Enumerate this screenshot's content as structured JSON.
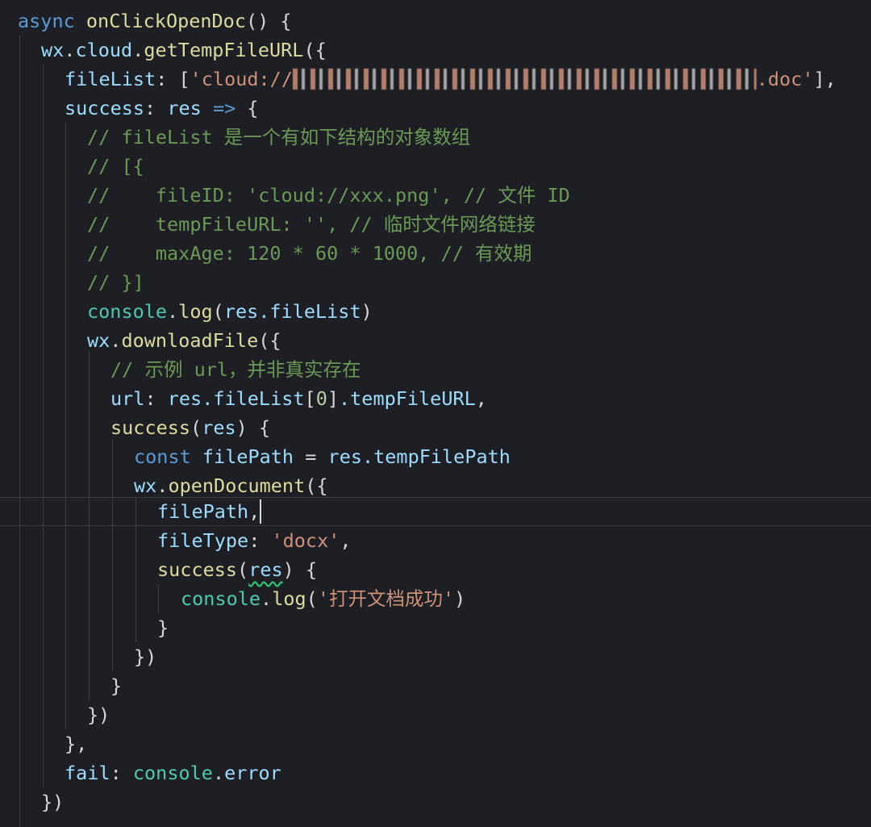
{
  "code": {
    "l1_kw": "async",
    "l1_fn": "onClickOpenDoc",
    "l1_rest": "() {",
    "l2_obj": "wx",
    "l2_dot1": ".",
    "l2_cloud": "cloud",
    "l2_dot2": ".",
    "l2_fn": "getTempFileURL",
    "l2_rest": "({",
    "l3_key": "fileList",
    "l3_sep": ": [",
    "l3_str_start": "'cloud://",
    "l3_str_end": ".doc'",
    "l3_rest": "],",
    "l4_key": "success",
    "l4_sep": ": ",
    "l4_res": "res",
    "l4_arrow": " => ",
    "l4_brace": "{",
    "l5": "// fileList 是一个有如下结构的对象数组",
    "l6": "// [{",
    "l7": "//    fileID: 'cloud://xxx.png', // 文件 ID",
    "l8": "//    tempFileURL: '', // 临时文件网络链接",
    "l9": "//    maxAge: 120 * 60 * 1000, // 有效期",
    "l10": "// }]",
    "l11_console": "console",
    "l11_dot": ".",
    "l11_log": "log",
    "l11_open": "(",
    "l11_arg": "res.fileList",
    "l11_close": ")",
    "l12_obj": "wx",
    "l12_dot": ".",
    "l12_fn": "downloadFile",
    "l12_rest": "({",
    "l13": "// 示例 url，并非真实存在",
    "l14_key": "url",
    "l14_sep": ": ",
    "l14_val": "res.fileList",
    "l14_idx_open": "[",
    "l14_idx": "0",
    "l14_idx_close": "]",
    "l14_prop": ".tempFileURL",
    "l14_end": ",",
    "l15_fn": "success",
    "l15_open": "(",
    "l15_arg": "res",
    "l15_rest": ") {",
    "l16_kw": "const",
    "l16_var": " filePath",
    "l16_eq": " = ",
    "l16_val": "res.tempFilePath",
    "l17_obj": "wx",
    "l17_dot": ".",
    "l17_fn": "openDocument",
    "l17_rest": "({",
    "l18_key": "filePath",
    "l18_end": ",",
    "l19_key": "fileType",
    "l19_sep": ": ",
    "l19_val": "'docx'",
    "l19_end": ",",
    "l20_fn": "success",
    "l20_open": "(",
    "l20_arg": "res",
    "l20_rest": ") {",
    "l21_console": "console",
    "l21_dot": ".",
    "l21_log": "log",
    "l21_open": "(",
    "l21_str": "'打开文档成功'",
    "l21_close": ")",
    "l22": "}",
    "l23": "})",
    "l24": "}",
    "l25": "})",
    "l26": "},",
    "l27_key": "fail",
    "l27_sep": ": ",
    "l27_console": "console",
    "l27_dot": ".",
    "l27_err": "error",
    "l28": "})"
  }
}
